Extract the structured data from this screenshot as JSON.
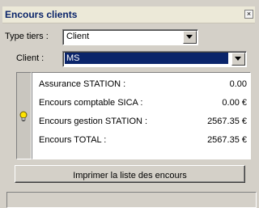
{
  "window": {
    "title": "Encours clients",
    "close_glyph": "×"
  },
  "filters": {
    "type_tiers_label": "Type tiers :",
    "type_tiers_value": "Client",
    "client_label": "Client :",
    "client_value": "MS"
  },
  "info": {
    "icon": "lightbulb-icon",
    "rows": [
      {
        "label": "Assurance STATION :",
        "value": "0.00"
      },
      {
        "label": "Encours comptable SICA :",
        "value": "0.00 €"
      },
      {
        "label": "Encours gestion STATION :",
        "value": "2567.35 €"
      },
      {
        "label": "Encours TOTAL :",
        "value": "2567.35 €"
      }
    ]
  },
  "actions": {
    "print_label": "Imprimer la liste des encours"
  }
}
